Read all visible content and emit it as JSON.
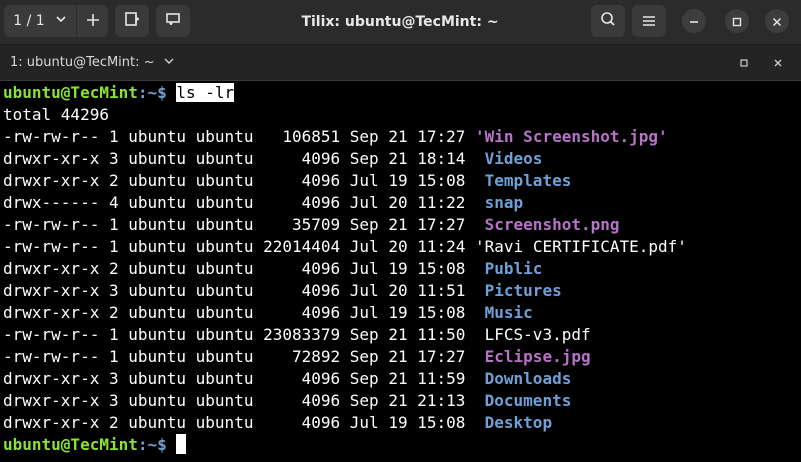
{
  "window": {
    "title": "Tilix: ubuntu@TecMint: ~"
  },
  "toolbar": {
    "session_label": "1 / 1",
    "icons": [
      "chevron-down-icon",
      "plus-icon",
      "split-horizontal-icon",
      "split-vertical-icon",
      "search-icon",
      "hamburger-menu-icon",
      "minimize-icon",
      "maximize-icon",
      "close-icon"
    ]
  },
  "tab": {
    "label": "1: ubuntu@TecMint: ~"
  },
  "terminal": {
    "prompt_user": "ubuntu@TecMint",
    "prompt_sep": ":~$ ",
    "command": "ls -lr",
    "total": "total 44296",
    "rows": [
      {
        "meta": "-rw-rw-r-- 1 ubuntu ubuntu   106851 Sep 21 17:27 ",
        "name": "'Win Screenshot.jpg'",
        "kind": "img"
      },
      {
        "meta": "drwxr-xr-x 3 ubuntu ubuntu     4096 Sep 21 18:14  ",
        "name": "Videos",
        "kind": "dir"
      },
      {
        "meta": "drwxr-xr-x 2 ubuntu ubuntu     4096 Jul 19 15:08  ",
        "name": "Templates",
        "kind": "dir"
      },
      {
        "meta": "drwx------ 4 ubuntu ubuntu     4096 Jul 20 11:22  ",
        "name": "snap",
        "kind": "dir"
      },
      {
        "meta": "-rw-rw-r-- 1 ubuntu ubuntu    35709 Sep 21 17:27  ",
        "name": "Screenshot.png",
        "kind": "img"
      },
      {
        "meta": "-rw-rw-r-- 1 ubuntu ubuntu 22014404 Jul 20 11:24 ",
        "name": "'Ravi CERTIFICATE.pdf'",
        "kind": "plain"
      },
      {
        "meta": "drwxr-xr-x 2 ubuntu ubuntu     4096 Jul 19 15:08  ",
        "name": "Public",
        "kind": "dir"
      },
      {
        "meta": "drwxr-xr-x 3 ubuntu ubuntu     4096 Jul 20 11:51  ",
        "name": "Pictures",
        "kind": "dir"
      },
      {
        "meta": "drwxr-xr-x 2 ubuntu ubuntu     4096 Jul 19 15:08  ",
        "name": "Music",
        "kind": "dir"
      },
      {
        "meta": "-rw-rw-r-- 1 ubuntu ubuntu 23083379 Sep 21 11:50  ",
        "name": "LFCS-v3.pdf",
        "kind": "plain"
      },
      {
        "meta": "-rw-rw-r-- 1 ubuntu ubuntu    72892 Sep 21 17:27  ",
        "name": "Eclipse.jpg",
        "kind": "img"
      },
      {
        "meta": "drwxr-xr-x 3 ubuntu ubuntu     4096 Sep 21 11:59  ",
        "name": "Downloads",
        "kind": "dir"
      },
      {
        "meta": "drwxr-xr-x 3 ubuntu ubuntu     4096 Sep 21 21:13  ",
        "name": "Documents",
        "kind": "dir"
      },
      {
        "meta": "drwxr-xr-x 2 ubuntu ubuntu     4096 Jul 19 15:08  ",
        "name": "Desktop",
        "kind": "dir"
      }
    ]
  },
  "colors": {
    "prompt_user": "#8ae234",
    "prompt_path": "#729fcf",
    "directory": "#6fa0d8",
    "image": "#b872c8",
    "titlebar": "#2b2b2b"
  }
}
